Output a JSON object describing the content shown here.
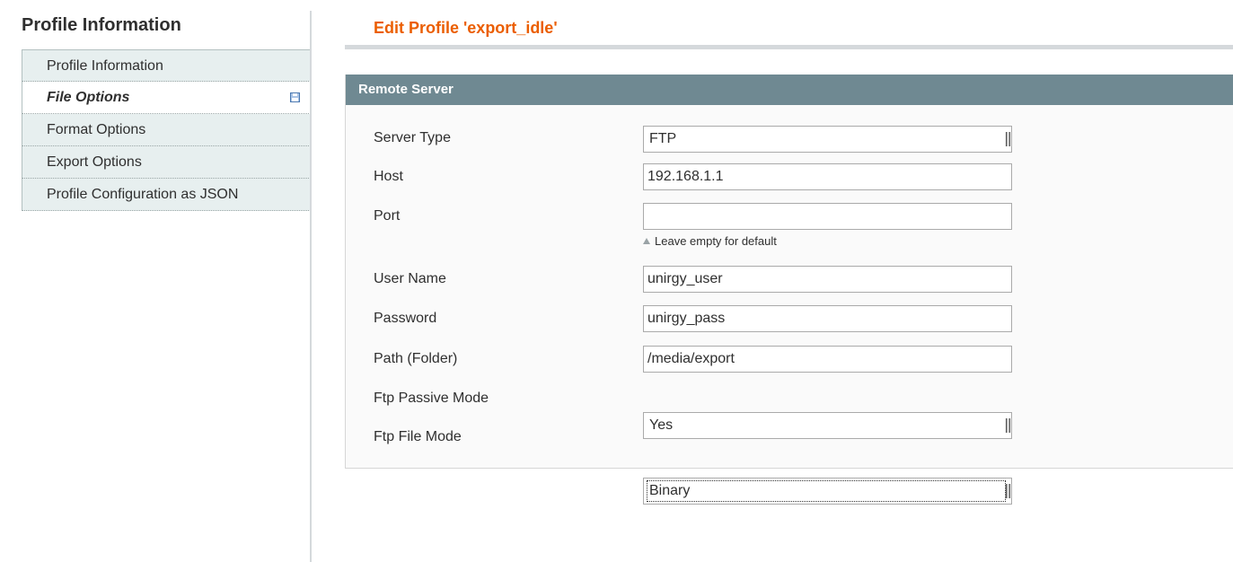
{
  "sidebar": {
    "title": "Profile Information",
    "tabs": [
      {
        "label": "Profile Information",
        "active": false
      },
      {
        "label": "File Options",
        "active": true,
        "icon": "save-icon"
      },
      {
        "label": "Format Options",
        "active": false
      },
      {
        "label": "Export Options",
        "active": false
      },
      {
        "label": "Profile Configuration as JSON",
        "active": false
      }
    ]
  },
  "main": {
    "title": "Edit Profile 'export_idle'",
    "fieldset": {
      "header": "Remote Server",
      "fields": {
        "server_type": {
          "label": "Server Type",
          "value": "FTP"
        },
        "host": {
          "label": "Host",
          "value": "192.168.1.1"
        },
        "port": {
          "label": "Port",
          "value": "",
          "note": "Leave empty for default"
        },
        "user_name": {
          "label": "User Name",
          "value": "unirgy_user"
        },
        "password": {
          "label": "Password",
          "value": "unirgy_pass"
        },
        "path": {
          "label": "Path (Folder)",
          "value": "/media/export"
        },
        "ftp_passive_mode": {
          "label": "Ftp Passive Mode",
          "value": "Yes"
        },
        "ftp_file_mode": {
          "label": "Ftp File Mode",
          "value": "Binary"
        }
      }
    }
  },
  "colors": {
    "title_accent": "#eb5e00",
    "header_bar": "#6f8992",
    "tab_bg": "#e7efef"
  }
}
